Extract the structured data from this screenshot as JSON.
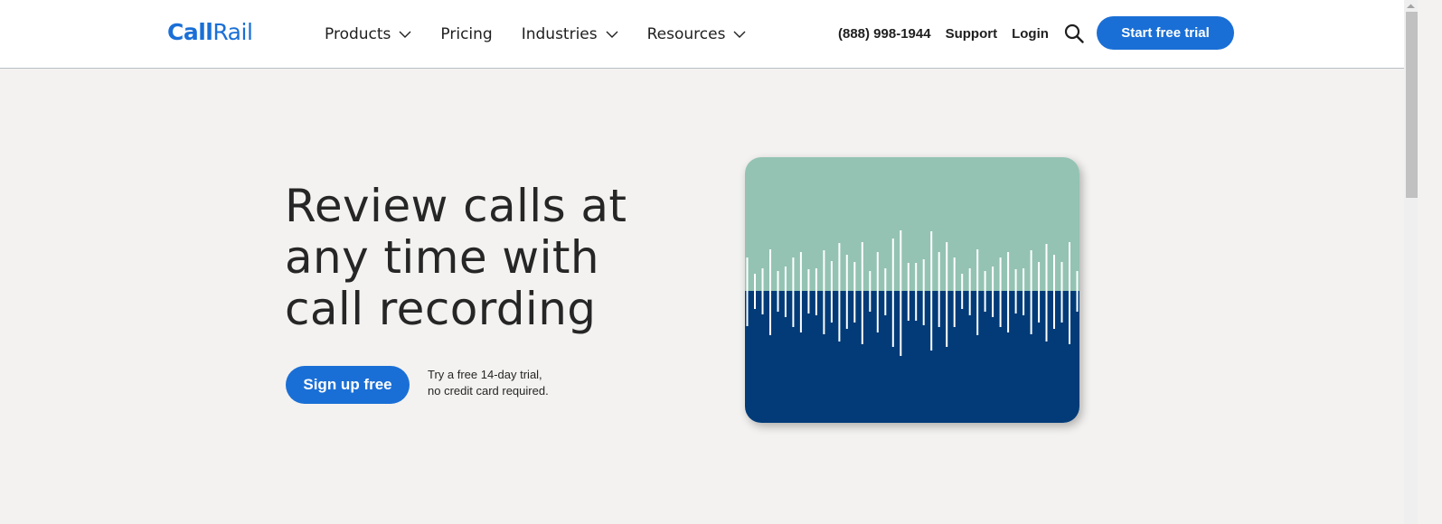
{
  "header": {
    "logo": {
      "bold": "Call",
      "light": "Rail"
    },
    "nav": [
      {
        "label": "Products",
        "has_dropdown": true
      },
      {
        "label": "Pricing",
        "has_dropdown": false
      },
      {
        "label": "Industries",
        "has_dropdown": true
      },
      {
        "label": "Resources",
        "has_dropdown": true
      }
    ],
    "utility": {
      "phone": "(888) 998-1944",
      "support": "Support",
      "login": "Login",
      "search_icon": "search-icon"
    },
    "cta_label": "Start free trial"
  },
  "hero": {
    "title_lines": [
      "Review calls at",
      "any time with",
      "call recording"
    ],
    "signup_label": "Sign up free",
    "note_lines": [
      "Try a free 14-day trial,",
      "no credit card required."
    ]
  },
  "illustration": {
    "type": "audio-waveform",
    "colors": {
      "top": "#94c3b3",
      "bottom": "#023b78",
      "bars": "#ffffff"
    },
    "split_ratio": 0.503,
    "bars": [
      {
        "up": 0.37,
        "down": 0.39
      },
      {
        "up": 0.19,
        "down": 0.2
      },
      {
        "up": 0.25,
        "down": 0.26
      },
      {
        "up": 0.46,
        "down": 0.49
      },
      {
        "up": 0.22,
        "down": 0.23
      },
      {
        "up": 0.27,
        "down": 0.29
      },
      {
        "up": 0.37,
        "down": 0.4
      },
      {
        "up": 0.43,
        "down": 0.46
      },
      {
        "up": 0.24,
        "down": 0.25
      },
      {
        "up": 0.25,
        "down": 0.27
      },
      {
        "up": 0.45,
        "down": 0.48
      },
      {
        "up": 0.33,
        "down": 0.35
      },
      {
        "up": 0.53,
        "down": 0.56
      },
      {
        "up": 0.4,
        "down": 0.42
      },
      {
        "up": 0.32,
        "down": 0.35
      },
      {
        "up": 0.54,
        "down": 0.59
      },
      {
        "up": 0.22,
        "down": 0.23
      },
      {
        "up": 0.43,
        "down": 0.46
      },
      {
        "up": 0.25,
        "down": 0.27
      },
      {
        "up": 0.58,
        "down": 0.62
      },
      {
        "up": 0.67,
        "down": 0.72
      },
      {
        "up": 0.31,
        "down": 0.33
      },
      {
        "up": 0.31,
        "down": 0.33
      },
      {
        "up": 0.35,
        "down": 0.38
      },
      {
        "up": 0.66,
        "down": 0.66
      },
      {
        "up": 0.43,
        "down": 0.4
      },
      {
        "up": 0.54,
        "down": 0.62
      },
      {
        "up": 0.37,
        "down": 0.4
      },
      {
        "up": 0.19,
        "down": 0.2
      },
      {
        "up": 0.25,
        "down": 0.27
      },
      {
        "up": 0.46,
        "down": 0.49
      },
      {
        "up": 0.22,
        "down": 0.23
      },
      {
        "up": 0.27,
        "down": 0.29
      },
      {
        "up": 0.37,
        "down": 0.4
      },
      {
        "up": 0.43,
        "down": 0.46
      },
      {
        "up": 0.24,
        "down": 0.25
      },
      {
        "up": 0.25,
        "down": 0.27
      },
      {
        "up": 0.45,
        "down": 0.48
      },
      {
        "up": 0.32,
        "down": 0.35
      },
      {
        "up": 0.52,
        "down": 0.56
      },
      {
        "up": 0.4,
        "down": 0.42
      },
      {
        "up": 0.32,
        "down": 0.35
      },
      {
        "up": 0.54,
        "down": 0.59
      },
      {
        "up": 0.22,
        "down": 0.23
      }
    ]
  }
}
